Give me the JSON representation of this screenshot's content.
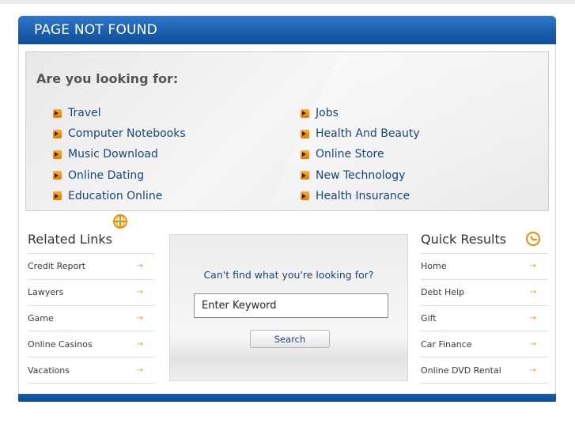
{
  "header": {
    "title": "PAGE NOT FOUND"
  },
  "suggestions": {
    "heading": "Are you looking for:",
    "left": [
      "Travel",
      "Computer Notebooks",
      "Music Download",
      "Online Dating",
      "Education Online"
    ],
    "right": [
      "Jobs",
      "Health And Beauty",
      "Online Store",
      "New Technology",
      "Health Insurance"
    ]
  },
  "related": {
    "title": "Related Links",
    "icon": "globe-icon",
    "items": [
      "Credit Report",
      "Lawyers",
      "Game",
      "Online Casinos",
      "Vacations"
    ]
  },
  "search": {
    "question": "Can't find what you're looking for?",
    "value": "Enter Keyword",
    "button_label": "Search"
  },
  "quick": {
    "title": "Quick Results",
    "icon": "clock-icon",
    "items": [
      "Home",
      "Debt Help",
      "Gift",
      "Car Finance",
      "Online DVD Rental"
    ]
  },
  "arrow_glyph": "→",
  "colors": {
    "header_blue": "#1b5fae",
    "link_blue": "#16467c",
    "accent_orange": "#f08c00"
  }
}
